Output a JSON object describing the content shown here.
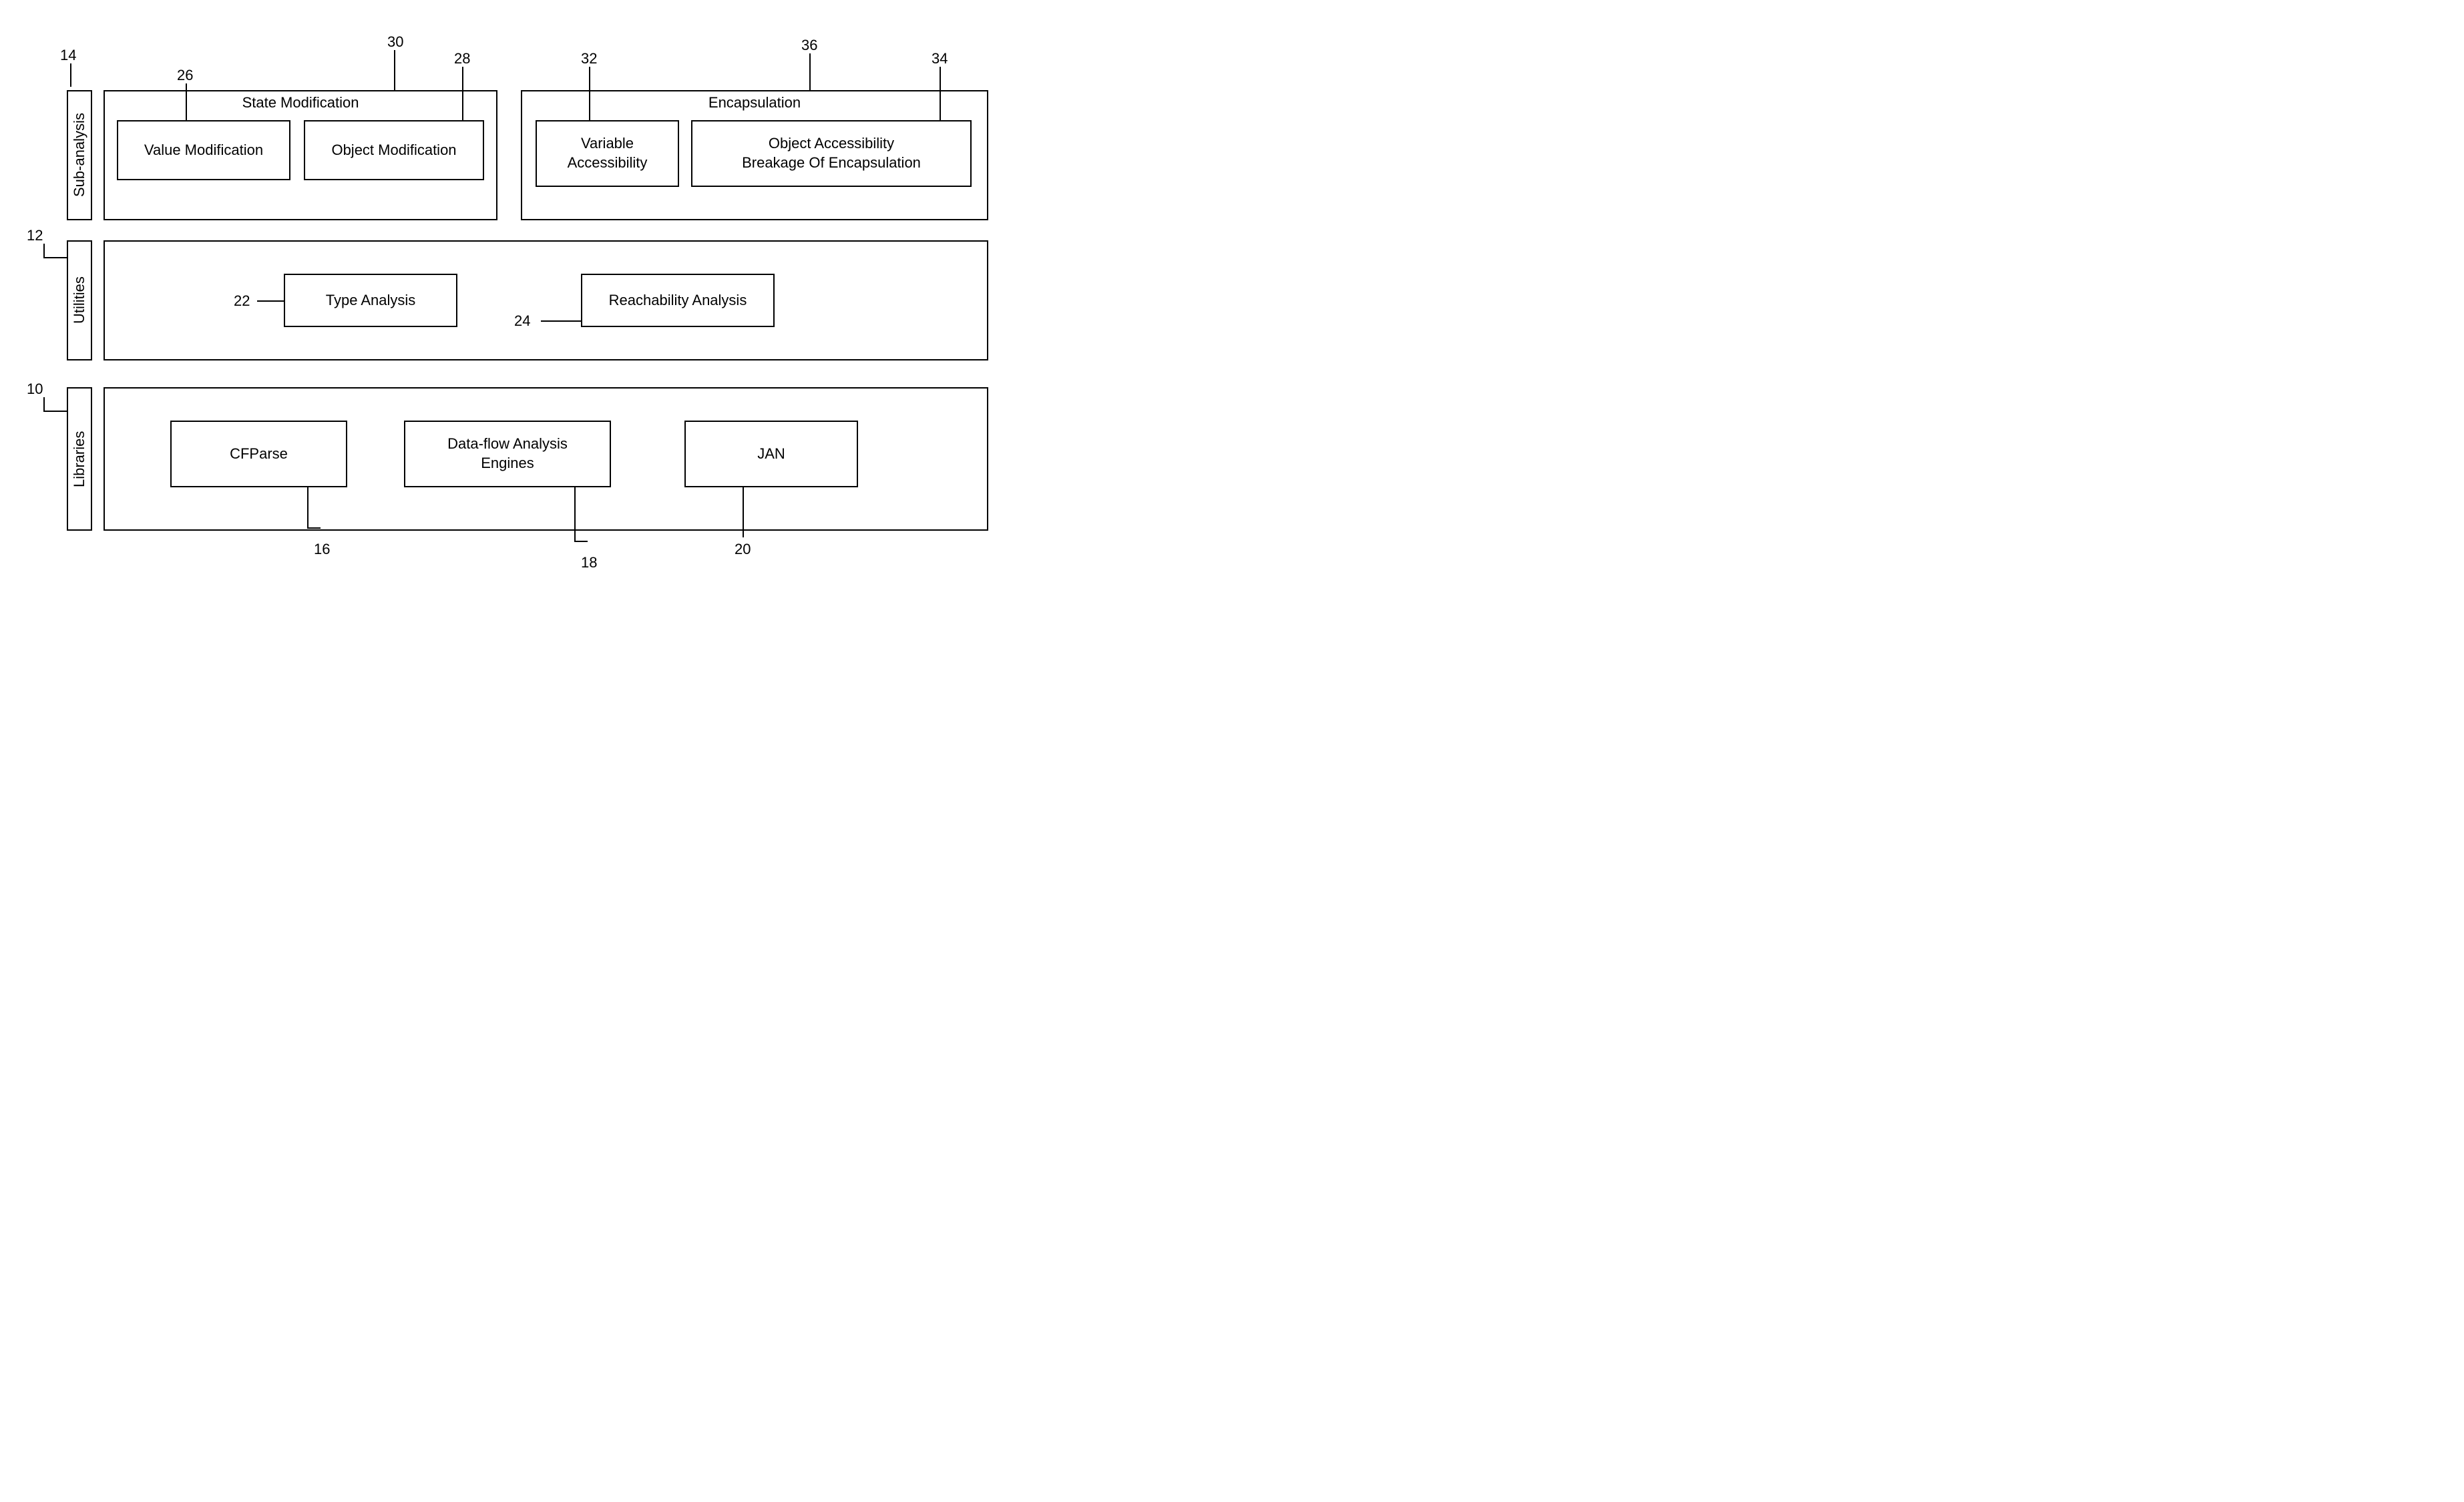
{
  "rows": {
    "sub_analysis": {
      "label": "Sub-analysis",
      "callout": "14"
    },
    "utilities": {
      "label": "Utilities",
      "callout": "12"
    },
    "libraries": {
      "label": "Libraries",
      "callout": "10"
    }
  },
  "groups": {
    "state_modification": {
      "title": "State Modification",
      "callout": "30"
    },
    "encapsulation": {
      "title": "Encapsulation",
      "callout": "36"
    }
  },
  "boxes": {
    "value_modification": {
      "label": "Value Modification",
      "callout": "26"
    },
    "object_modification": {
      "label": "Object Modification",
      "callout": "28"
    },
    "variable_accessibility": {
      "label": "Variable\nAccessibility",
      "callout": "32"
    },
    "object_accessibility": {
      "label": "Object Accessibility\nBreakage Of Encapsulation",
      "callout": "34"
    },
    "type_analysis": {
      "label": "Type Analysis",
      "callout": "22"
    },
    "reachability_analysis": {
      "label": "Reachability Analysis",
      "callout": "24"
    },
    "cfparse": {
      "label": "CFParse",
      "callout": "16"
    },
    "dataflow_engines": {
      "label": "Data-flow Analysis\nEngines",
      "callout": "18"
    },
    "jan": {
      "label": "JAN",
      "callout": "20"
    }
  }
}
